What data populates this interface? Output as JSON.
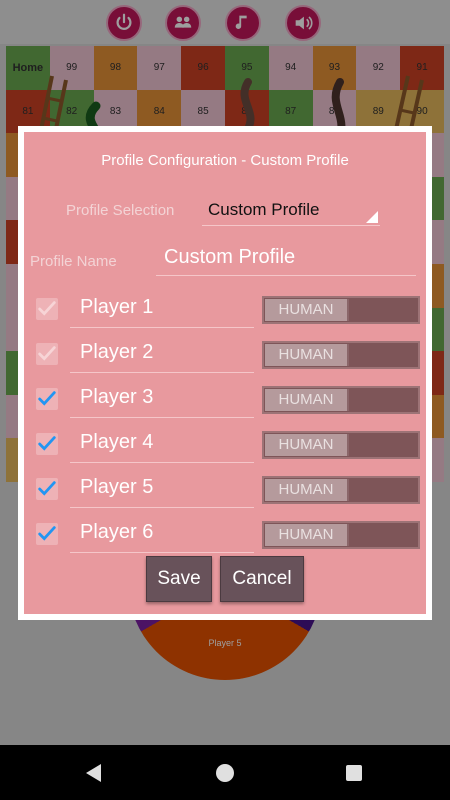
{
  "top_bar": {
    "icons": [
      "power-icon",
      "players-icon",
      "music-icon",
      "sound-icon"
    ]
  },
  "board": {
    "home_label": "Home",
    "row_top": [
      "99",
      "98",
      "97",
      "96",
      "95",
      "94",
      "93",
      "92",
      "91"
    ],
    "row_second": [
      "81",
      "82",
      "83",
      "84",
      "85",
      "86",
      "87",
      "88",
      "89",
      "90"
    ]
  },
  "wheel": {
    "visible_label": "Player 5"
  },
  "dialog": {
    "title": "Profile Configuration - Custom Profile",
    "profile_selection_label": "Profile Selection",
    "profile_selection_value": "Custom Profile",
    "profile_name_label": "Profile Name",
    "profile_name_value": "Custom Profile",
    "players": [
      {
        "name": "Player 1",
        "type": "HUMAN",
        "checked": true,
        "enabled": false
      },
      {
        "name": "Player 2",
        "type": "HUMAN",
        "checked": true,
        "enabled": false
      },
      {
        "name": "Player 3",
        "type": "HUMAN",
        "checked": true,
        "enabled": true
      },
      {
        "name": "Player 4",
        "type": "HUMAN",
        "checked": true,
        "enabled": true
      },
      {
        "name": "Player 5",
        "type": "HUMAN",
        "checked": true,
        "enabled": true
      },
      {
        "name": "Player 6",
        "type": "HUMAN",
        "checked": true,
        "enabled": true
      }
    ],
    "save_label": "Save",
    "cancel_label": "Cancel"
  },
  "colors": {
    "dialog_bg": "#e8999e",
    "check_active": "#2196f3",
    "check_disabled": "#f7d4d6",
    "button_bg": "#68525a"
  }
}
